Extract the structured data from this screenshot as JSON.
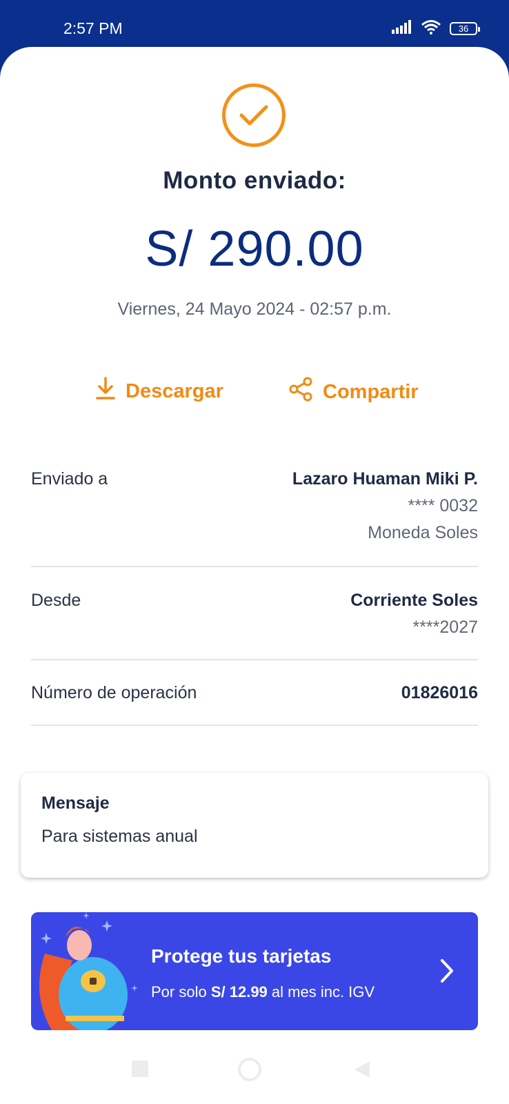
{
  "status_bar": {
    "time": "2:57 PM",
    "battery": "36"
  },
  "receipt": {
    "title": "Monto enviado:",
    "amount": "S/ 290.00",
    "date": "Viernes, 24 Mayo 2024 - 02:57 p.m."
  },
  "actions": {
    "download_label": "Descargar",
    "share_label": "Compartir"
  },
  "details": {
    "sent_to": {
      "label": "Enviado a",
      "name": "Lazaro Huaman Miki P.",
      "account": "**** 0032",
      "currency": "Moneda Soles"
    },
    "from": {
      "label": "Desde",
      "account_type": "Corriente Soles",
      "account": "****2027"
    },
    "operation": {
      "label": "Número de operación",
      "number": "01826016"
    }
  },
  "message": {
    "title": "Mensaje",
    "text": "Para sistemas anual"
  },
  "promo": {
    "title": "Protege tus tarjetas",
    "sub_prefix": "Por solo",
    "price": "S/ 12.99",
    "sub_suffix": "al mes inc. IGV"
  },
  "colors": {
    "brand_blue": "#0a2f8c",
    "accent_orange": "#f18a14",
    "promo_bg": "#3a47e6"
  }
}
